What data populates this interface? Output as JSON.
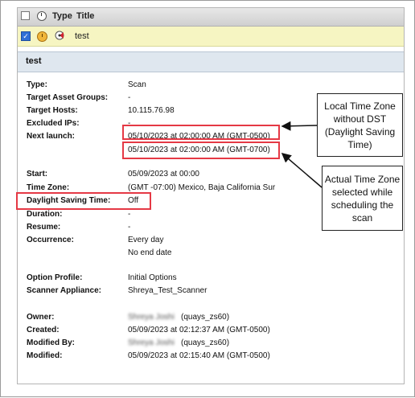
{
  "list": {
    "header": {
      "type_label": "Type",
      "title_label": "Title"
    },
    "row": {
      "checked": true,
      "title": "test",
      "row_icons": [
        "scheduled-clock-icon",
        "scan-icon"
      ]
    }
  },
  "detail": {
    "title": "test",
    "fields": [
      {
        "label": "Type:",
        "value": "Scan"
      },
      {
        "label": "Target Asset Groups:",
        "value": "-"
      },
      {
        "label": "Target Hosts:",
        "value": "10.115.76.98"
      },
      {
        "label": "Excluded IPs:",
        "value": "-"
      },
      {
        "label": "Next launch:",
        "value": "05/10/2023 at 02:00:00 AM (GMT-0500)"
      },
      {
        "label": "",
        "value": "05/10/2023 at 02:00:00 AM (GMT-0700)"
      },
      {
        "label": "Start:",
        "value": "05/09/2023 at 00:00"
      },
      {
        "label": "Time Zone:",
        "value": "(GMT -07:00) Mexico, Baja California Sur"
      },
      {
        "label": "Daylight Saving Time:",
        "value": "Off"
      },
      {
        "label": "Duration:",
        "value": "-"
      },
      {
        "label": "Resume:",
        "value": "-"
      },
      {
        "label": "Occurrence:",
        "value": "Every day"
      },
      {
        "label": "",
        "value": "No end date"
      },
      {
        "label": "Option Profile:",
        "value": "Initial Options"
      },
      {
        "label": "Scanner Appliance:",
        "value": "Shreya_Test_Scanner"
      },
      {
        "label": "Owner:",
        "value_blurred": "Shreya Joshi",
        "value": "(quays_zs60)"
      },
      {
        "label": "Created:",
        "value": "05/09/2023 at 02:12:37 AM (GMT-0500)"
      },
      {
        "label": "Modified By:",
        "value_blurred": "Shreya Joshi",
        "value": "(quays_zs60)"
      },
      {
        "label": "Modified:",
        "value": "05/09/2023 at 02:15:40 AM (GMT-0500)"
      }
    ]
  },
  "annotations": {
    "local": "Local Time Zone without DST (Daylight Saving Time)",
    "actual": "Actual Time Zone selected while scheduling the scan",
    "highlight_color": "#e53945"
  }
}
